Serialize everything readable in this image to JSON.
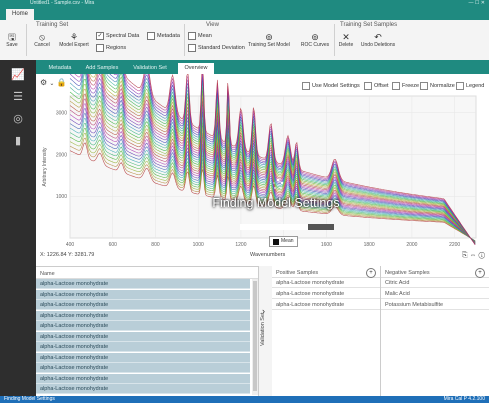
{
  "window": {
    "title": "Untitled1 - Sample.csv - Mira",
    "controls": "— ☐ ✕"
  },
  "menu": {
    "home_tab": "Home"
  },
  "ribbon": {
    "groups": {
      "training_set": "Training Set",
      "view": "View",
      "training_set_samples": "Training Set Samples"
    },
    "save": "Save",
    "cancel": "Cancel",
    "model_expert": "Model Expert",
    "spectral_data": "Spectral Data",
    "metadata": "Metadata",
    "mean": "Mean",
    "regions": "Regions",
    "standard_deviation": "Standard Deviation",
    "training_set_model": "Training Set Model",
    "roc_curves": "ROC Curves",
    "delete": "Delete",
    "undo_deletions": "Undo Deletions"
  },
  "tabs": [
    "Metadata",
    "Add Samples",
    "Validation Set",
    "Overview"
  ],
  "plot_options": [
    "Use Model Settings",
    "Offset",
    "Freeze",
    "Normalize",
    "Legend"
  ],
  "overlay": {
    "text": "Finding Model Settings",
    "progress": 0.72
  },
  "legend": {
    "label": "Mean"
  },
  "coordinate_readout": "X: 1226.84  Y: 3281.79",
  "axes": {
    "xlabel": "Wavenumbers",
    "ylabel": "Arbitrary Intensity"
  },
  "chart_data": {
    "type": "line",
    "xlabel": "Wavenumbers",
    "ylabel": "Arbitrary Intensity",
    "x_ticks": [
      400,
      600,
      800,
      1000,
      1200,
      1400,
      1600,
      1800,
      2000,
      2200
    ],
    "y_ticks": [
      1000,
      2000,
      3000
    ],
    "xlim": [
      400,
      2300
    ],
    "ylim": [
      0,
      3400
    ],
    "series_count": 30
  },
  "sample_list": {
    "header": "Name",
    "rows": [
      "alpha-Lactose monohydrate",
      "alpha-Lactose monohydrate",
      "alpha-Lactose monohydrate",
      "alpha-Lactose monohydrate",
      "alpha-Lactose monohydrate",
      "alpha-Lactose monohydrate",
      "alpha-Lactose monohydrate",
      "alpha-Lactose monohydrate",
      "alpha-Lactose monohydrate",
      "alpha-Lactose monohydrate",
      "alpha-Lactose monohydrate"
    ]
  },
  "validation_set": {
    "label": "Validation Set",
    "positive": {
      "header": "Positive Samples",
      "rows": [
        "alpha-Lactose monohydrate",
        "alpha-Lactose monohydrate",
        "alpha-Lactose monohydrate"
      ]
    },
    "negative": {
      "header": "Negative Samples",
      "rows": [
        "Citric Acid",
        "Malic Acid",
        "Potassium Metabisulfite"
      ]
    }
  },
  "status": {
    "left": "Finding Model Settings",
    "right": "Mira Cal P 4.2.100"
  }
}
